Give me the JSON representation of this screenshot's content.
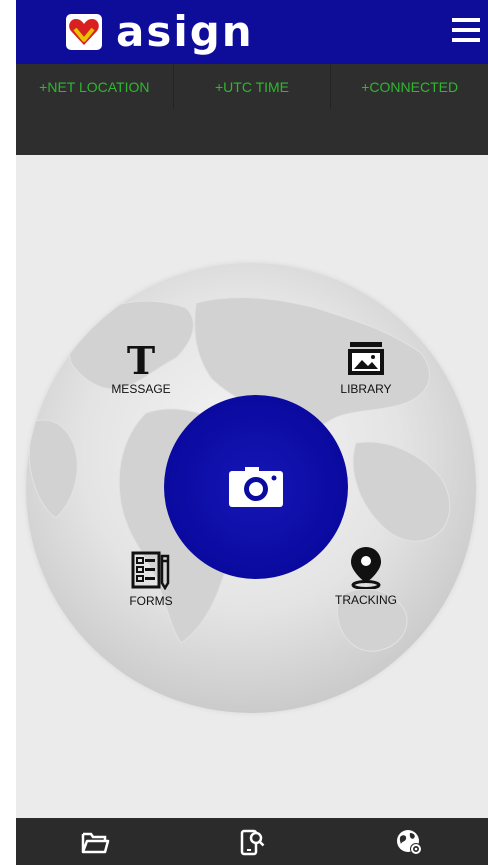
{
  "header": {
    "logo_text": "asign",
    "logo_icon": "asign-heart-logo",
    "menu_icon": "hamburger-menu-icon"
  },
  "status": {
    "items": [
      {
        "label": "+NET LOCATION"
      },
      {
        "label": "+UTC TIME"
      },
      {
        "label": "+CONNECTED"
      }
    ],
    "color": "#2eb82e"
  },
  "main": {
    "camera_icon": "camera-icon",
    "actions": {
      "message": {
        "label": "MESSAGE",
        "icon": "text-t-icon"
      },
      "library": {
        "label": "LIBRARY",
        "icon": "image-library-icon"
      },
      "forms": {
        "label": "FORMS",
        "icon": "form-icon"
      },
      "tracking": {
        "label": "TRACKING",
        "icon": "map-pin-icon"
      }
    }
  },
  "bottom_nav": {
    "items": [
      {
        "icon": "folder-open-icon"
      },
      {
        "icon": "phone-search-icon"
      },
      {
        "icon": "globe-settings-icon"
      }
    ]
  },
  "colors": {
    "brand_blue": "#0d0d9a",
    "dark_bar": "#2e2e2e",
    "background": "#ebebeb"
  }
}
